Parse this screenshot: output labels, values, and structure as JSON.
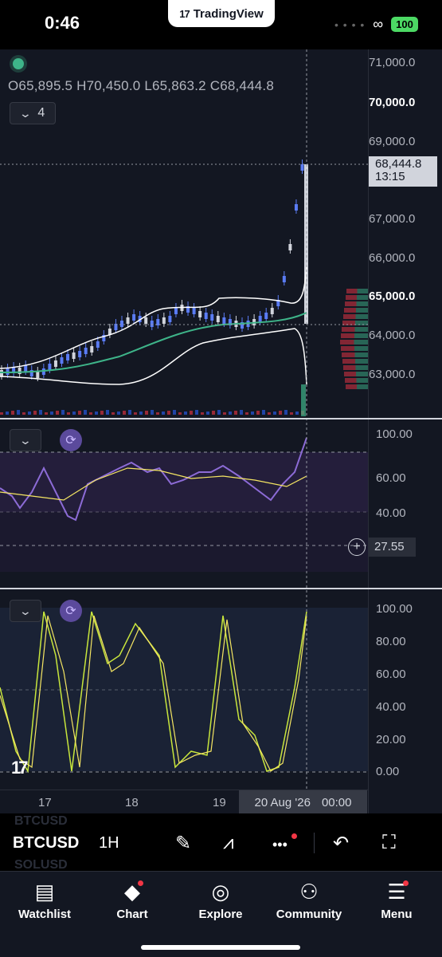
{
  "status_bar": {
    "time": "0:46",
    "app_name": "TradingView",
    "battery": "100"
  },
  "chart": {
    "ohlc": {
      "open": "O65,895.5",
      "high": "H70,450.0",
      "low": "L65,863.2",
      "close": "C68,444.8"
    },
    "hidden_indicators_count": "4",
    "current_price": "68,444.8",
    "countdown": "13:15",
    "price_axis": [
      "71,000.0",
      "70,000.0",
      "69,000.0",
      "67,000.0",
      "66,000.0",
      "65,000.0",
      "64,000.0",
      "63,000.0"
    ],
    "rsi_axis": [
      "100.00",
      "60.00",
      "40.00"
    ],
    "crosshair_value": "27.55",
    "stoch_axis": [
      "100.00",
      "80.00",
      "60.00",
      "40.00",
      "20.00",
      "0.00"
    ],
    "time_axis": [
      "17",
      "18",
      "19"
    ],
    "date_label": "20 Aug '26",
    "time_label": "00:00",
    "colors": {
      "bg": "#131722",
      "up": "#5b7cf4",
      "down": "#d1d4dc",
      "rsi": "#8c6bd6",
      "stoch_k": "#c8e63c",
      "stoch_d": "#f5e663",
      "bb": "#ffffff",
      "ma": "#3eb489"
    }
  },
  "toolbar": {
    "ghost_top": "BTCUSD",
    "symbol": "BTCUSD",
    "interval": "1H",
    "ghost_bottom": "SOLUSD"
  },
  "nav": {
    "watchlist": "Watchlist",
    "chart": "Chart",
    "explore": "Explore",
    "community": "Community",
    "menu": "Menu"
  },
  "icons": [
    "link-icon",
    "draw-icon",
    "trendline-icon",
    "more-icon",
    "undo-icon",
    "fullscreen-icon",
    "watchlist-icon",
    "chart-icon",
    "explore-icon",
    "community-icon",
    "menu-icon"
  ]
}
